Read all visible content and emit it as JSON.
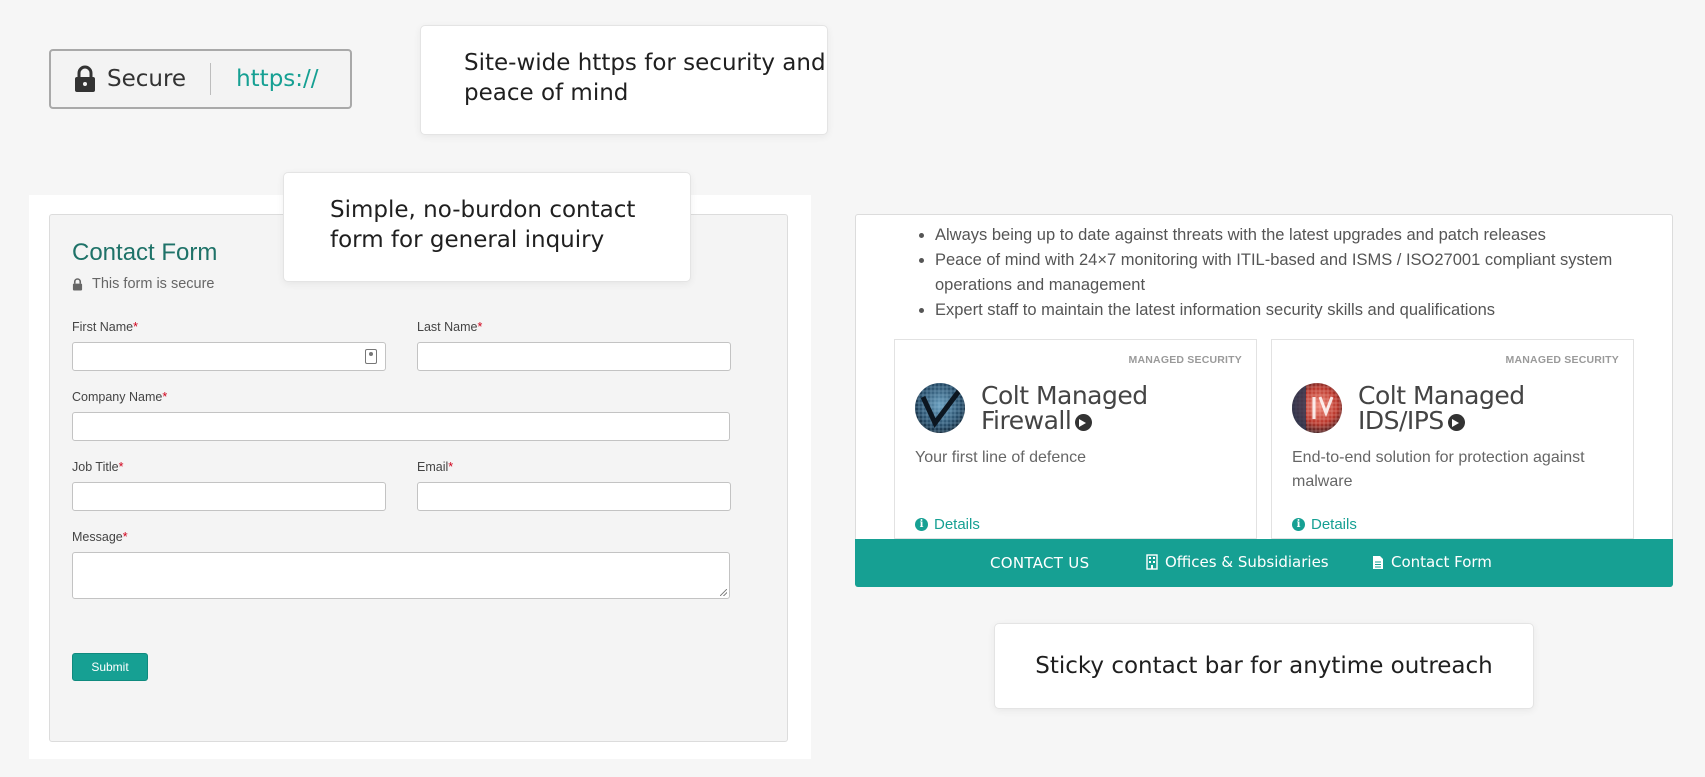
{
  "url_bar": {
    "secure_label": "Secure",
    "protocol": "https://"
  },
  "callouts": {
    "https": "Site-wide https for security and peace of mind",
    "form": "Simple, no-burdon contact form for general inquiry",
    "sticky": "Sticky contact bar for anytime outreach"
  },
  "contact_form": {
    "title": "Contact Form",
    "secure_note": "This form is secure",
    "fields": {
      "first_name": "First Name",
      "last_name": "Last Name",
      "company_name": "Company Name",
      "job_title": "Job Title",
      "email": "Email",
      "message": "Message"
    },
    "required_marker": "*",
    "submit_label": "Submit"
  },
  "benefits": [
    "Always being up to date against threats with the latest upgrades and patch releases",
    "Peace of mind with 24×7 monitoring with ITIL-based and ISMS / ISO27001 compliant system operations and management",
    "Expert staff to maintain the latest information security skills and qualifications"
  ],
  "products": [
    {
      "tag": "MANAGED SECURITY",
      "title_line1": "Colt Managed",
      "title_line2": "Firewall",
      "description": "Your first line of defence",
      "details_label": "Details"
    },
    {
      "tag": "MANAGED SECURITY",
      "title_line1": "Colt Managed",
      "title_line2": "IDS/IPS",
      "description": "End-to-end solution for protection against malware",
      "details_label": "Details"
    }
  ],
  "sticky_bar": {
    "contact_us": "CONTACT US",
    "offices": "Offices & Subsidiaries",
    "contact_form": "Contact Form"
  },
  "colors": {
    "brand_teal": "#16a093",
    "title_green": "#1e7268",
    "required_red": "#d0021b"
  }
}
